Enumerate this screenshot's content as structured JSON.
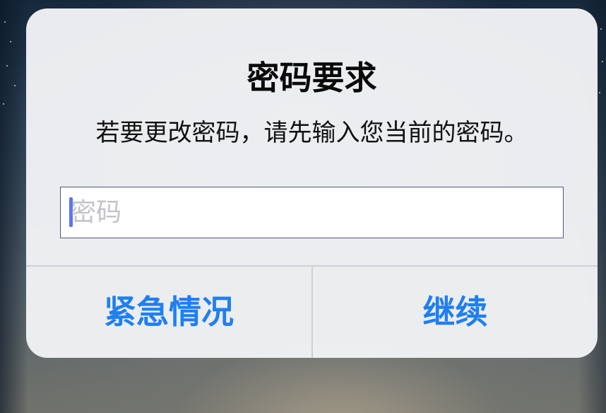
{
  "alert": {
    "title": "密码要求",
    "message": "若要更改密码，请先输入您当前的密码。",
    "password_field": {
      "placeholder": "密码",
      "value": ""
    },
    "buttons": {
      "emergency_label": "紧急情况",
      "continue_label": "继续"
    }
  },
  "colors": {
    "accent": "#1f7ff0",
    "caret": "#5b74f0",
    "dialog_background": "#f1f2f4"
  }
}
